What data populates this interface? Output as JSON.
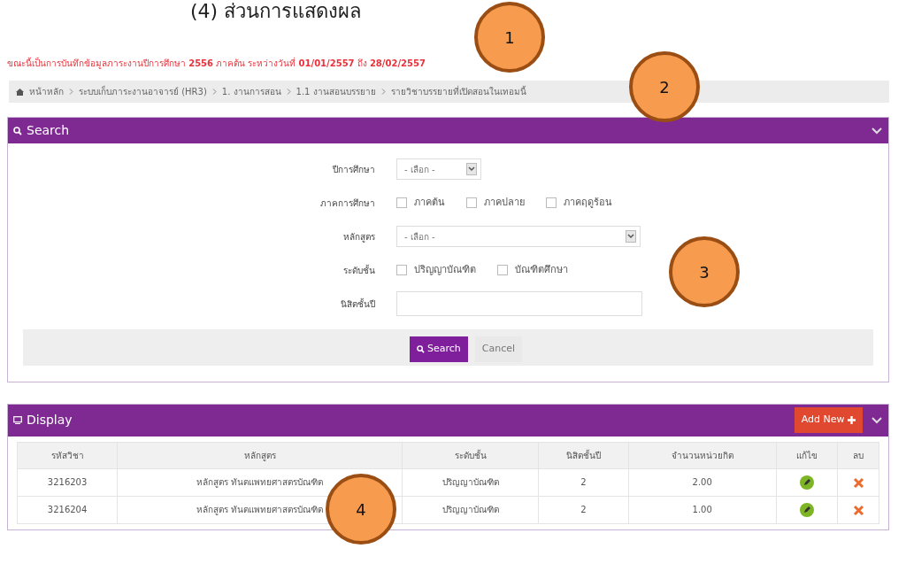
{
  "caption": "(4)  ส่วนการแสดงผล",
  "notice": "ขณะนี้เป็นการบันทึกข้อมูลภาระงานปีการศึกษา **2556** ภาคต้น ระหว่างวันที่ **01/01/2557** ถึง **28/02/2557**",
  "breadcrumb": [
    "หน้าหลัก",
    "ระบบเก็บภาระงานอาจารย์ (HR3)",
    "1. งานการสอน",
    "1.1 งานสอนบรรยาย",
    "รายวิชาบรรยายที่เปิดสอนในเทอมนี้"
  ],
  "search_panel": {
    "title": "Search",
    "fields": [
      {
        "kind": "select",
        "label": "ปีการศึกษา",
        "value": "- เลือก -",
        "wide": false
      },
      {
        "kind": "checks",
        "label": "ภาคการศึกษา",
        "options": [
          {
            "label": "ภาคต้น",
            "checked": false
          },
          {
            "label": "ภาคปลาย",
            "checked": false
          },
          {
            "label": "ภาคฤดูร้อน",
            "checked": false
          }
        ]
      },
      {
        "kind": "select",
        "label": "หลักสูตร",
        "value": "- เลือก -",
        "wide": true
      },
      {
        "kind": "checks",
        "label": "ระดับชั้น",
        "options": [
          {
            "label": "ปริญญาบัณฑิต",
            "checked": false
          },
          {
            "label": "บัณฑิตศึกษา",
            "checked": false
          }
        ]
      },
      {
        "kind": "text",
        "label": "นิสิตชั้นปี"
      }
    ],
    "buttons": [
      "Search",
      "Cancel"
    ]
  },
  "display_panel": {
    "title": "Display",
    "add_button": "Add New",
    "columns": [
      "รหัสวิชา",
      "หลักสูตร",
      "ระดับชั้น",
      "นิสิตชั้นปี",
      "จำนวนหน่วยกิต",
      "แก้ไข",
      "ลบ"
    ],
    "rows": [
      {
        "code": "3216203",
        "program": "หลักสูตร ทันตแพทยศาสตรบัณฑิต",
        "level": "ปริญญาบัณฑิต",
        "year": "2",
        "credits": "2.00"
      },
      {
        "code": "3216204",
        "program": "หลักสูตร ทันตแพทยศาสตรบัณฑิต",
        "level": "ปริญญาบัณฑิต",
        "year": "2",
        "credits": "1.00"
      }
    ]
  },
  "callouts": [
    "1",
    "2",
    "3",
    "4"
  ]
}
